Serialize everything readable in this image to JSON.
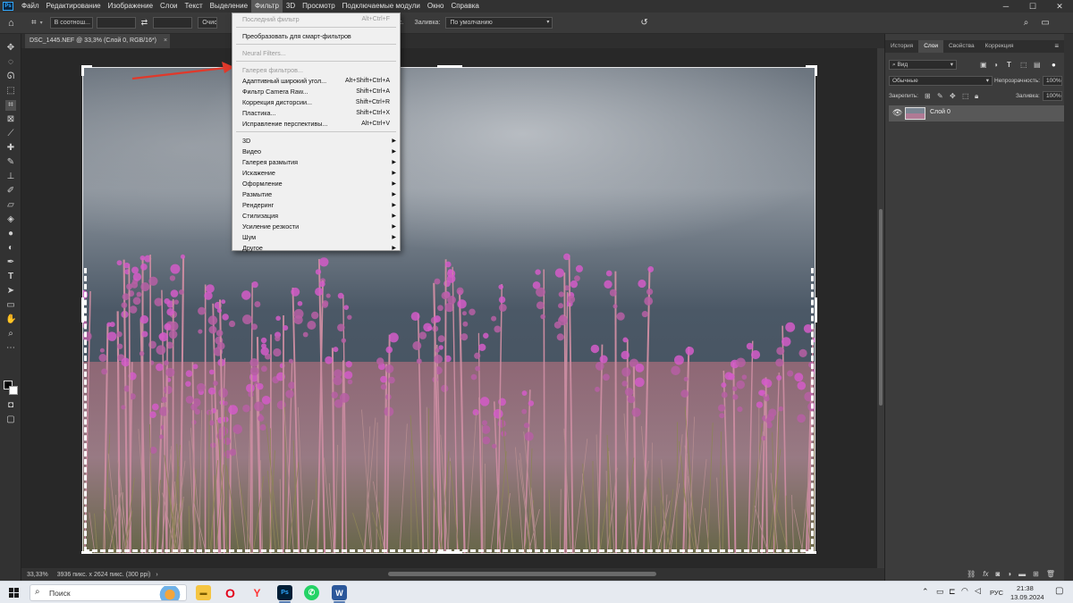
{
  "menubar": {
    "items": [
      "Файл",
      "Редактирование",
      "Изображение",
      "Слои",
      "Текст",
      "Выделение",
      "Фильтр",
      "3D",
      "Просмотр",
      "Подключаемые модули",
      "Окно",
      "Справка"
    ],
    "active_index": 6,
    "app_icon": "photoshop-logo",
    "window_controls": [
      "minimize-icon",
      "maximize-icon",
      "close-icon"
    ]
  },
  "options": {
    "ratio": "В соотнош...",
    "clear_btn": "Очистить",
    "pix_text": "пикс.",
    "fill_label": "Заливка:",
    "fill_value": "По умолчанию"
  },
  "document": {
    "tab_title": "DSC_1445.NEF @ 33,3% (Слой 0, RGB/16*)",
    "close_glyph": "×"
  },
  "status": {
    "zoom": "33,33%",
    "info": "3936 пикс. x 2624 пикс. (300 ppi)",
    "arrow": "›"
  },
  "filter_menu": {
    "items": [
      {
        "label": "Последний фильтр",
        "shortcut": "Alt+Ctrl+F",
        "disabled": true
      },
      {
        "sep": true
      },
      {
        "label": "Преобразовать для смарт-фильтров",
        "shortcut": "",
        "disabled": false
      },
      {
        "sep": true
      },
      {
        "label": "Neural Filters...",
        "shortcut": "",
        "disabled": true
      },
      {
        "sep": true
      },
      {
        "label": "Галерея фильтров...",
        "shortcut": "",
        "disabled": true
      },
      {
        "label": "Адаптивный широкий угол...",
        "shortcut": "Alt+Shift+Ctrl+A",
        "disabled": false
      },
      {
        "label": "Фильтр Camera Raw...",
        "shortcut": "Shift+Ctrl+A",
        "disabled": false
      },
      {
        "label": "Коррекция дисторсии...",
        "shortcut": "Shift+Ctrl+R",
        "disabled": false
      },
      {
        "label": "Пластика...",
        "shortcut": "Shift+Ctrl+X",
        "disabled": false
      },
      {
        "label": "Исправление перспективы...",
        "shortcut": "Alt+Ctrl+V",
        "disabled": false
      },
      {
        "sep": true
      },
      {
        "label": "3D",
        "submenu": true
      },
      {
        "label": "Видео",
        "submenu": true
      },
      {
        "label": "Галерея размытия",
        "submenu": true
      },
      {
        "label": "Искажение",
        "submenu": true
      },
      {
        "label": "Оформление",
        "submenu": true
      },
      {
        "label": "Размытие",
        "submenu": true
      },
      {
        "label": "Рендеринг",
        "submenu": true
      },
      {
        "label": "Стилизация",
        "submenu": true
      },
      {
        "label": "Усиление резкости",
        "submenu": true
      },
      {
        "label": "Шум",
        "submenu": true
      },
      {
        "label": "Другое",
        "submenu": true
      }
    ]
  },
  "panel": {
    "tabs": [
      "История",
      "Слои",
      "Свойства",
      "Коррекция"
    ],
    "active_tab": 1,
    "filter_kind": "Вид",
    "blend_mode": "Обычные",
    "opacity_label": "Непрозрачность:",
    "opacity_value": "100%",
    "lock_label": "Закрепить:",
    "fill_label": "Заливка:",
    "fill_value": "100%",
    "layer_name": "Слой 0"
  },
  "taskbar": {
    "search_placeholder": "Поиск",
    "lang": "РУС",
    "time": "21:38",
    "date": "13.09.2024",
    "apps": [
      "explorer-icon",
      "opera-icon",
      "yandex-icon",
      "photoshop-icon",
      "whatsapp-icon",
      "word-icon"
    ]
  },
  "colors": {
    "accent": "#31a8ff",
    "arrow_annotation": "#e0392b"
  }
}
